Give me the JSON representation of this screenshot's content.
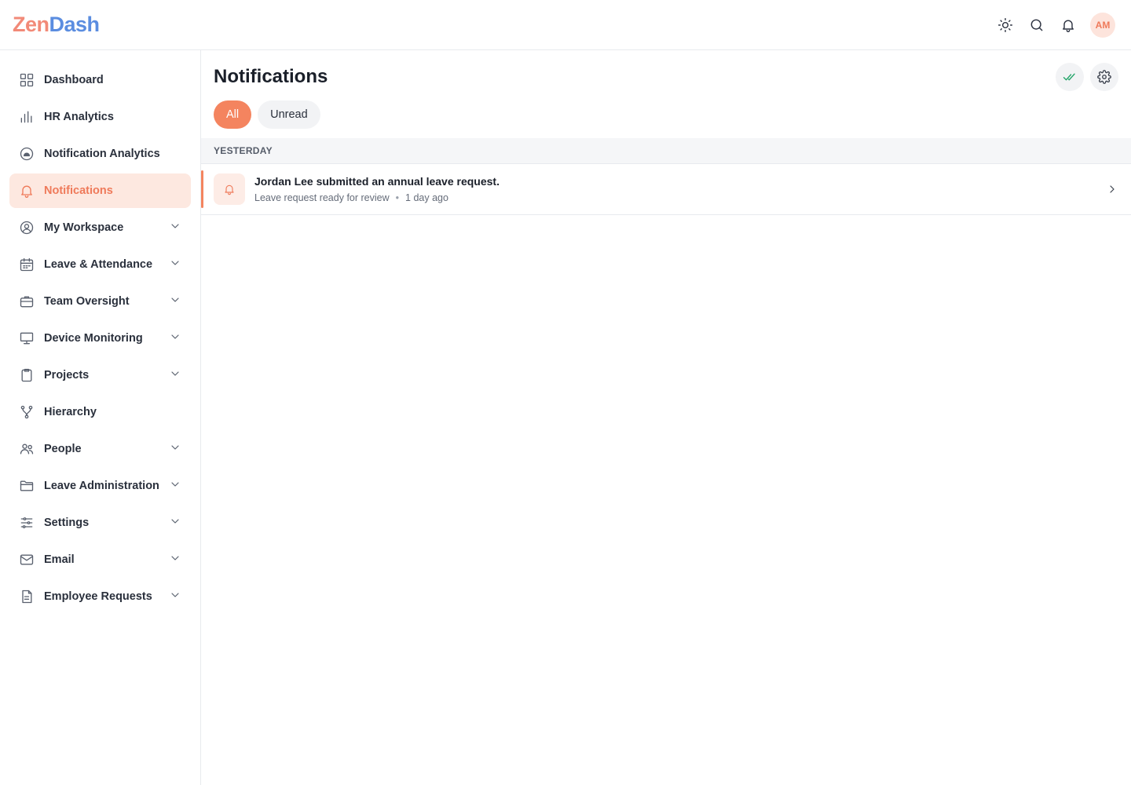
{
  "app": {
    "logo_part1": "Zen",
    "logo_part2": "Dash",
    "avatar_initials": "AM"
  },
  "topbar": {
    "icons": [
      "sun-icon",
      "search-icon",
      "bell-icon"
    ]
  },
  "sidebar": {
    "items": [
      {
        "label": "Dashboard",
        "icon": "grid-icon",
        "expandable": false,
        "active": false
      },
      {
        "label": "HR Analytics",
        "icon": "bar-chart-icon",
        "expandable": false,
        "active": false
      },
      {
        "label": "Notification Analytics",
        "icon": "analytics-circle-icon",
        "expandable": false,
        "active": false
      },
      {
        "label": "Notifications",
        "icon": "bell-icon",
        "expandable": false,
        "active": true
      },
      {
        "label": "My Workspace",
        "icon": "user-circle-icon",
        "expandable": true,
        "active": false
      },
      {
        "label": "Leave & Attendance",
        "icon": "calendar-icon",
        "expandable": true,
        "active": false
      },
      {
        "label": "Team Oversight",
        "icon": "briefcase-icon",
        "expandable": true,
        "active": false
      },
      {
        "label": "Device Monitoring",
        "icon": "monitor-icon",
        "expandable": true,
        "active": false
      },
      {
        "label": "Projects",
        "icon": "clipboard-icon",
        "expandable": true,
        "active": false
      },
      {
        "label": "Hierarchy",
        "icon": "hierarchy-icon",
        "expandable": false,
        "active": false
      },
      {
        "label": "People",
        "icon": "users-icon",
        "expandable": true,
        "active": false
      },
      {
        "label": "Leave Administration",
        "icon": "folder-icon",
        "expandable": true,
        "active": false
      },
      {
        "label": "Settings",
        "icon": "sliders-icon",
        "expandable": true,
        "active": false
      },
      {
        "label": "Email",
        "icon": "mail-icon",
        "expandable": true,
        "active": false
      },
      {
        "label": "Employee Requests",
        "icon": "document-icon",
        "expandable": true,
        "active": false
      }
    ]
  },
  "main": {
    "title": "Notifications",
    "filters": [
      {
        "label": "All",
        "active": true
      },
      {
        "label": "Unread",
        "active": false
      }
    ],
    "section_label": "YESTERDAY",
    "notifications": [
      {
        "title": "Jordan Lee submitted an annual leave request.",
        "subtitle": "Leave request ready for review",
        "separator": "•",
        "time": "1 day ago"
      }
    ]
  },
  "colors": {
    "accent": "#f4845f",
    "accent_soft": "#fde8e0",
    "success": "#25a56a"
  }
}
